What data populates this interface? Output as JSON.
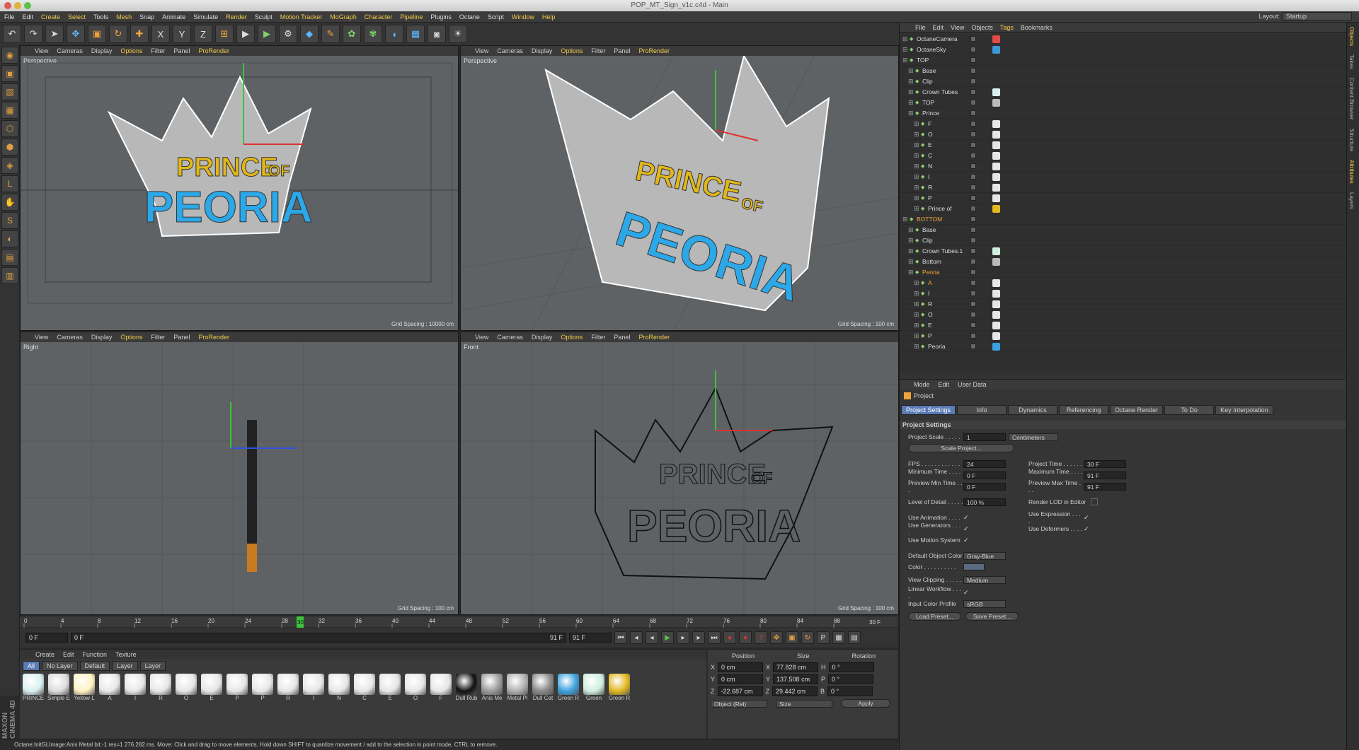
{
  "window": {
    "title": "POP_MT_Sign_v1c.c4d - Main"
  },
  "menubar": [
    "File",
    "Edit",
    "Create",
    "Select",
    "Tools",
    "Mesh",
    "Snap",
    "Animate",
    "Simulate",
    "Render",
    "Sculpt",
    "Motion Tracker",
    "MoGraph",
    "Character",
    "Pipeline",
    "Plugins",
    "Octane",
    "Script",
    "Window",
    "Help"
  ],
  "layout": {
    "label": "Layout:",
    "value": "Startup"
  },
  "viewports": [
    {
      "name": "Perspective",
      "grid": "Grid Spacing : 10000 cm"
    },
    {
      "name": "Perspective",
      "grid": "Grid Spacing : 100 cm"
    },
    {
      "name": "Right",
      "grid": "Grid Spacing : 100 cm"
    },
    {
      "name": "Front",
      "grid": "Grid Spacing : 100 cm"
    }
  ],
  "viewport_menu": [
    "View",
    "Cameras",
    "Display",
    "Options",
    "Filter",
    "Panel",
    "ProRender"
  ],
  "viewport_text": {
    "line1": "PRINCE",
    "line1b": "OF",
    "line2": "PEORIA"
  },
  "timeline": {
    "ticks": [
      "0",
      "4",
      "8",
      "12",
      "16",
      "20",
      "24",
      "28",
      "32",
      "36",
      "40",
      "44",
      "48",
      "52",
      "56",
      "60",
      "64",
      "68",
      "72",
      "76",
      "80",
      "84",
      "88"
    ],
    "current": "30",
    "end": "30 F",
    "start_field": "0 F",
    "slider_start": "0 F",
    "slider_end": "91 F",
    "end_field": "91 F"
  },
  "material_manager": {
    "menu": [
      "Create",
      "Edit",
      "Function",
      "Texture"
    ],
    "filters": [
      "All",
      "No Layer",
      "Default",
      "Layer",
      "Layer"
    ],
    "materials": [
      {
        "name": "PRINCE",
        "color": "#d8f0f0"
      },
      {
        "name": "Simple E",
        "color": "#dcdcdc"
      },
      {
        "name": "Yellow L",
        "color": "#fff2c0"
      },
      {
        "name": "A",
        "color": "#e6e6e6"
      },
      {
        "name": "I",
        "color": "#e6e6e6"
      },
      {
        "name": "R",
        "color": "#e6e6e6"
      },
      {
        "name": "O",
        "color": "#e6e6e6"
      },
      {
        "name": "E",
        "color": "#e6e6e6"
      },
      {
        "name": "P",
        "color": "#e6e6e6"
      },
      {
        "name": "P",
        "color": "#e6e6e6"
      },
      {
        "name": "R",
        "color": "#e6e6e6"
      },
      {
        "name": "I",
        "color": "#e6e6e6"
      },
      {
        "name": "N",
        "color": "#e6e6e6"
      },
      {
        "name": "C",
        "color": "#e6e6e6"
      },
      {
        "name": "E",
        "color": "#e6e6e6"
      },
      {
        "name": "O",
        "color": "#e6e6e6"
      },
      {
        "name": "F",
        "color": "#e6e6e6"
      },
      {
        "name": "Dull Rub",
        "color": "#111111"
      },
      {
        "name": "Anis Me",
        "color": "#9a9a9a"
      },
      {
        "name": "Metal Pl",
        "color": "#b0b0b0"
      },
      {
        "name": "Dull Cat",
        "color": "#888888"
      },
      {
        "name": "Green R",
        "color": "#3aa0e0"
      },
      {
        "name": "Green",
        "color": "#cfeee0"
      },
      {
        "name": "Green R",
        "color": "#e0b820"
      }
    ]
  },
  "coordinates": {
    "headers": [
      "Position",
      "Size",
      "Rotation"
    ],
    "rows": [
      {
        "axis": "X",
        "pos": "0 cm",
        "sizeAxis": "X",
        "size": "77.828 cm",
        "rotAxis": "H",
        "rot": "0 °"
      },
      {
        "axis": "Y",
        "pos": "0 cm",
        "sizeAxis": "Y",
        "size": "137.508 cm",
        "rotAxis": "P",
        "rot": "0 °"
      },
      {
        "axis": "Z",
        "pos": "-22.687 cm",
        "sizeAxis": "Z",
        "size": "29.442 cm",
        "rotAxis": "B",
        "rot": "0 °"
      }
    ],
    "mode1": "Object (Rel)",
    "mode2": "Size",
    "apply": "Apply"
  },
  "status": "Octane:InitGLImage:Anis Metal  bit:-1 res=1  276.282 ms.     Move: Click and drag to move elements. Hold down SHIFT to quantize movement / add to the selection in point mode, CTRL to remove.",
  "maxon": "MAXON CINEMA 4D",
  "object_manager": {
    "menu": [
      "File",
      "Edit",
      "View",
      "Objects",
      "Tags",
      "Bookmarks"
    ],
    "objects": [
      {
        "name": "OctaneCamera",
        "indent": 0,
        "color": "#dcdcdc",
        "tag": "#e24a4a"
      },
      {
        "name": "OctaneSky",
        "indent": 0,
        "color": "#dcdcdc",
        "tag": "#3a9ad9"
      },
      {
        "name": "TOP",
        "indent": 0,
        "color": "#dcdcdc",
        "tag": ""
      },
      {
        "name": "Base",
        "indent": 1,
        "color": "#dcdcdc",
        "tag": ""
      },
      {
        "name": "Clip",
        "indent": 1,
        "color": "#dcdcdc",
        "tag": ""
      },
      {
        "name": "Crown Tubes",
        "indent": 1,
        "color": "#dcdcdc",
        "tag": "#d8f0f0"
      },
      {
        "name": "TOP",
        "indent": 1,
        "color": "#dcdcdc",
        "tag": "#bbbbbb"
      },
      {
        "name": "Prince",
        "indent": 1,
        "color": "#dcdcdc",
        "tag": ""
      },
      {
        "name": "F",
        "indent": 2,
        "color": "#dcdcdc",
        "tag": "#e6e6e6"
      },
      {
        "name": "O",
        "indent": 2,
        "color": "#dcdcdc",
        "tag": "#e6e6e6"
      },
      {
        "name": "E",
        "indent": 2,
        "color": "#dcdcdc",
        "tag": "#e6e6e6"
      },
      {
        "name": "C",
        "indent": 2,
        "color": "#dcdcdc",
        "tag": "#e6e6e6"
      },
      {
        "name": "N",
        "indent": 2,
        "color": "#dcdcdc",
        "tag": "#e6e6e6"
      },
      {
        "name": "I",
        "indent": 2,
        "color": "#dcdcdc",
        "tag": "#e6e6e6"
      },
      {
        "name": "R",
        "indent": 2,
        "color": "#dcdcdc",
        "tag": "#e6e6e6"
      },
      {
        "name": "P",
        "indent": 2,
        "color": "#dcdcdc",
        "tag": "#e6e6e6"
      },
      {
        "name": "Prince of",
        "indent": 2,
        "color": "#dcdcdc",
        "tag": "#e0b820"
      },
      {
        "name": "BOTTOM",
        "indent": 0,
        "color": "#f0a33a",
        "tag": ""
      },
      {
        "name": "Base",
        "indent": 1,
        "color": "#dcdcdc",
        "tag": ""
      },
      {
        "name": "Clip",
        "indent": 1,
        "color": "#dcdcdc",
        "tag": ""
      },
      {
        "name": "Crown Tubes.1",
        "indent": 1,
        "color": "#dcdcdc",
        "tag": "#cfeee0"
      },
      {
        "name": "Bottom",
        "indent": 1,
        "color": "#dcdcdc",
        "tag": "#bbbbbb"
      },
      {
        "name": "Peoria",
        "indent": 1,
        "color": "#f0a33a",
        "tag": ""
      },
      {
        "name": "A",
        "indent": 2,
        "color": "#f0a33a",
        "tag": "#e6e6e6"
      },
      {
        "name": "I",
        "indent": 2,
        "color": "#dcdcdc",
        "tag": "#e6e6e6"
      },
      {
        "name": "R",
        "indent": 2,
        "color": "#dcdcdc",
        "tag": "#e6e6e6"
      },
      {
        "name": "O",
        "indent": 2,
        "color": "#dcdcdc",
        "tag": "#e6e6e6"
      },
      {
        "name": "E",
        "indent": 2,
        "color": "#dcdcdc",
        "tag": "#e6e6e6"
      },
      {
        "name": "P",
        "indent": 2,
        "color": "#dcdcdc",
        "tag": "#e6e6e6"
      },
      {
        "name": "Peoria",
        "indent": 2,
        "color": "#dcdcdc",
        "tag": "#3aa0e0"
      }
    ]
  },
  "sidetabs": [
    "Objects",
    "Takes",
    "Content Browser",
    "Structure",
    "Attributes",
    "Layers"
  ],
  "attributes": {
    "menu": [
      "Mode",
      "Edit",
      "User Data"
    ],
    "title": "Project",
    "tabs": [
      "Project Settings",
      "Info",
      "Dynamics",
      "Referencing",
      "Octane Render",
      "To Do",
      "Key Interpolation"
    ],
    "section": "Project Settings",
    "project_scale_label": "Project Scale . . . . .",
    "project_scale": "1",
    "units": "Centimeters",
    "scale_button": "Scale Project...",
    "left": [
      {
        "label": "FPS . . . . . . . . . . . .",
        "value": "24"
      },
      {
        "label": "Minimum Time . . . . .",
        "value": "0 F"
      },
      {
        "label": "Preview Min Time . . .",
        "value": "0 F"
      }
    ],
    "right": [
      {
        "label": "Project Time . . . . . .",
        "value": "30 F"
      },
      {
        "label": "Maximum Time . . . . .",
        "value": "91 F"
      },
      {
        "label": "Preview Max Time . . .",
        "value": "91 F"
      }
    ],
    "lod_label": "Level of Detail . . . . .",
    "lod": "100 %",
    "render_lod": "Render LOD in Editor",
    "checks_left": [
      "Use Animation . . . .",
      "Use Generators . . . .",
      "Use Motion System"
    ],
    "checks_right": [
      "Use Expression . . . .",
      "Use Deformers . . . ."
    ],
    "default_color_label": "Default Object Color",
    "default_color": "Gray-Blue",
    "color_label": "Color . . . . . . . . . .",
    "clipping_label": "View Clipping . . . . .",
    "clipping": "Medium",
    "linear_label": "Linear Workflow . . . .",
    "profile_label": "Input Color Profile",
    "profile": "sRGB",
    "load": "Load Preset...",
    "save": "Save Preset..."
  }
}
